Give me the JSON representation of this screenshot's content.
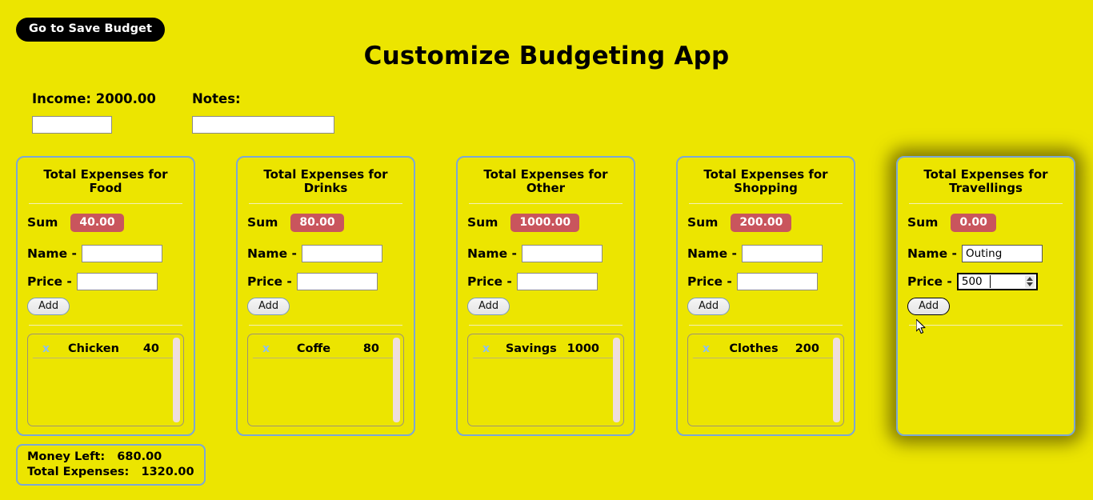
{
  "nav": {
    "save_budget_label": "Go to Save Budget"
  },
  "header": {
    "title": "Customize Budgeting App"
  },
  "meta": {
    "income_label": "Income: 2000.00",
    "income_value": "",
    "income_placeholder": "",
    "notes_label": "Notes:",
    "notes_value": "",
    "notes_placeholder": ""
  },
  "labels": {
    "sum": "Sum",
    "name": "Name -",
    "price": "Price -",
    "add": "Add",
    "delete_x": "x"
  },
  "colors": {
    "page_background": "#ece500",
    "card_border": "#7ba7d7",
    "sum_badge": "#c9555d",
    "nav_button": "#000000",
    "delete_link": "#8fc1ea",
    "scrollbar_track": "#efdede"
  },
  "cards": [
    {
      "title_line1": "Total Expenses for",
      "title_line2": "Food",
      "sum": "40.00",
      "name_value": "",
      "price_value": "",
      "focused": false,
      "items": [
        {
          "name": "Chicken",
          "price": "40"
        }
      ]
    },
    {
      "title_line1": "Total Expenses for",
      "title_line2": "Drinks",
      "sum": "80.00",
      "name_value": "",
      "price_value": "",
      "focused": false,
      "items": [
        {
          "name": "Coffe",
          "price": "80"
        }
      ]
    },
    {
      "title_line1": "Total Expenses for",
      "title_line2": "Other",
      "sum": "1000.00",
      "name_value": "",
      "price_value": "",
      "focused": false,
      "items": [
        {
          "name": "Savings",
          "price": "1000"
        }
      ]
    },
    {
      "title_line1": "Total Expenses for",
      "title_line2": "Shopping",
      "sum": "200.00",
      "name_value": "",
      "price_value": "",
      "focused": false,
      "items": [
        {
          "name": "Clothes",
          "price": "200"
        }
      ]
    },
    {
      "title_line1": "Total Expenses for",
      "title_line2": "Travellings",
      "sum": "0.00",
      "name_value": "Outing",
      "price_value": "500",
      "focused": true,
      "items": []
    }
  ],
  "totals": {
    "money_left": "Money Left:   680.00",
    "total_expenses": "Total Expenses:   1320.00"
  }
}
